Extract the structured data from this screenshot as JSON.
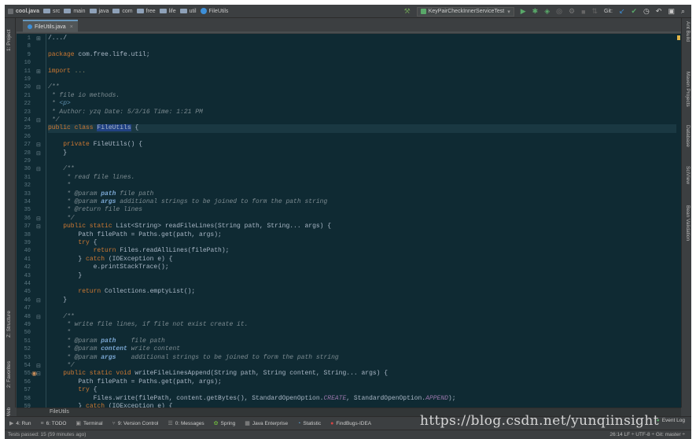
{
  "nav": {
    "crumbs": [
      {
        "label": "cool.java",
        "icon": "project-icon"
      },
      {
        "label": "src",
        "icon": "folder-icon"
      },
      {
        "label": "main",
        "icon": "folder-icon"
      },
      {
        "label": "java",
        "icon": "folder-icon"
      },
      {
        "label": "com",
        "icon": "folder-icon"
      },
      {
        "label": "free",
        "icon": "folder-icon"
      },
      {
        "label": "life",
        "icon": "folder-icon"
      },
      {
        "label": "util",
        "icon": "folder-icon"
      },
      {
        "label": "FileUtils",
        "icon": "class-icon"
      }
    ]
  },
  "toolbar": {
    "run_config": "KeyPairCheckInnerServiceTest",
    "git_label": "Git:"
  },
  "left_strip": {
    "project": "1: Project",
    "structure": "Z: Structure",
    "favorites": "2: Favorites",
    "web": "Web"
  },
  "right_strip": {
    "ant": "Ant Build",
    "maven": "Maven Projects",
    "database": "Database",
    "sciview": "SciView",
    "bean": "Bean Validation"
  },
  "tab": {
    "label": "FileUtils.java",
    "close": "×"
  },
  "code_lines": [
    {
      "n": "1",
      "html": "<span class='t'>/.../</span>"
    },
    {
      "n": "8",
      "html": ""
    },
    {
      "n": "9",
      "html": "<span class='k'>package </span><span class='t'>com.free.life.util;</span>"
    },
    {
      "n": "10",
      "html": ""
    },
    {
      "n": "11",
      "html": "<span class='k'>import </span><span class='t' style='color:#8a8a6a'>...</span>"
    },
    {
      "n": "19",
      "html": ""
    },
    {
      "n": "20",
      "html": "<span class='c'>/**</span>"
    },
    {
      "n": "21",
      "html": "<span class='c'> * file io methods.</span>"
    },
    {
      "n": "22",
      "html": "<span class='c'> * </span><span class='tg'>&lt;p&gt;</span>"
    },
    {
      "n": "23",
      "html": "<span class='c'> * Author: yzq Date: 5/3/16 Time: 1:21 PM</span>"
    },
    {
      "n": "24",
      "html": "<span class='c'> */</span>"
    },
    {
      "n": "25",
      "html": "<span class='k'>public class </span><span class='sel'>FileUtils</span><span class='t'> {</span>",
      "hl": true
    },
    {
      "n": "26",
      "html": ""
    },
    {
      "n": "27",
      "html": "    <span class='k'>private </span><span class='t'>FileUtils() {</span>"
    },
    {
      "n": "28",
      "html": "    <span class='t'>}</span>"
    },
    {
      "n": "29",
      "html": ""
    },
    {
      "n": "30",
      "html": "    <span class='c'>/**</span>"
    },
    {
      "n": "31",
      "html": "    <span class='c'> * read file lines.</span>"
    },
    {
      "n": "32",
      "html": "    <span class='c'> *</span>"
    },
    {
      "n": "33",
      "html": "    <span class='c'> * @param </span><span class='p'>path</span><span class='c'> file path</span>"
    },
    {
      "n": "34",
      "html": "    <span class='c'> * @param </span><span class='p'>args</span><span class='c'> additional strings to be joined to form the path string</span>"
    },
    {
      "n": "35",
      "html": "    <span class='c'> * @return file lines</span>"
    },
    {
      "n": "36",
      "html": "    <span class='c'> */</span>"
    },
    {
      "n": "37",
      "html": "    <span class='k'>public static </span><span class='t'>List&lt;String&gt; readFileLines(String path, String... args) {</span>"
    },
    {
      "n": "38",
      "html": "        <span class='t'>Path filePath = Paths.get(path, args);</span>"
    },
    {
      "n": "39",
      "html": "        <span class='k'>try </span><span class='t'>{</span>"
    },
    {
      "n": "40",
      "html": "            <span class='k'>return </span><span class='t'>Files.readAllLines(filePath);</span>"
    },
    {
      "n": "41",
      "html": "        <span class='t'>} </span><span class='k'>catch </span><span class='t'>(IOException e) {</span>"
    },
    {
      "n": "42",
      "html": "            <span class='t'>e.printStackTrace();</span>"
    },
    {
      "n": "43",
      "html": "        <span class='t'>}</span>"
    },
    {
      "n": "44",
      "html": ""
    },
    {
      "n": "45",
      "html": "        <span class='k'>return </span><span class='t'>Collections.emptyList();</span>"
    },
    {
      "n": "46",
      "html": "    <span class='t'>}</span>"
    },
    {
      "n": "47",
      "html": ""
    },
    {
      "n": "48",
      "html": "    <span class='c'>/**</span>"
    },
    {
      "n": "49",
      "html": "    <span class='c'> * write file lines, if file not exist create it.</span>"
    },
    {
      "n": "50",
      "html": "    <span class='c'> *</span>"
    },
    {
      "n": "51",
      "html": "    <span class='c'> * @param </span><span class='p'>path</span><span class='c'>    file path</span>"
    },
    {
      "n": "52",
      "html": "    <span class='c'> * @param </span><span class='p'>content</span><span class='c'> write content</span>"
    },
    {
      "n": "53",
      "html": "    <span class='c'> * @param </span><span class='p'>args</span><span class='c'>    additional strings to be joined to form the path string</span>"
    },
    {
      "n": "54",
      "html": "    <span class='c'> */</span>"
    },
    {
      "n": "55",
      "html": "    <span class='k'>public static void </span><span class='t'>writeFileLinesAppend(String path, String content, String... args) {</span>",
      "at": true
    },
    {
      "n": "56",
      "html": "        <span class='t'>Path filePath = Paths.get(path, args);</span>"
    },
    {
      "n": "57",
      "html": "        <span class='k'>try </span><span class='t'>{</span>"
    },
    {
      "n": "58",
      "html": "            <span class='t'>Files.write(filePath, content.getBytes(), StandardOpenOption.</span><span class='a'>CREATE</span><span class='t'>, StandardOpenOption.</span><span class='a'>APPEND</span><span class='t'>);</span>"
    },
    {
      "n": "59",
      "html": "        <span class='t'>} </span><span class='k'>catch </span><span class='t'>(IOException e) {</span>"
    }
  ],
  "breadcrumb_bottom": "FileUtils",
  "bottom_tabs": [
    {
      "label": "4: Run",
      "icon": "run-icon",
      "glyph": "▶"
    },
    {
      "label": "6: TODO",
      "icon": "todo-icon",
      "glyph": "≡"
    },
    {
      "label": "Terminal",
      "icon": "terminal-icon",
      "glyph": "▣"
    },
    {
      "label": "9: Version Control",
      "icon": "vcs-icon",
      "glyph": "⑂"
    },
    {
      "label": "0: Messages",
      "icon": "messages-icon",
      "glyph": "☰"
    },
    {
      "label": "Spring",
      "icon": "spring-icon",
      "glyph": "✿"
    },
    {
      "label": "Java Enterprise",
      "icon": "java-enterprise-icon",
      "glyph": "▦"
    },
    {
      "label": "Statistic",
      "icon": "statistic-icon",
      "glyph": "◔"
    },
    {
      "label": "FindBugs-IDEA",
      "icon": "findbugs-icon",
      "glyph": "●"
    }
  ],
  "event_log": "Event Log",
  "status": {
    "left": "Tests passed: 15 (59 minutes ago)",
    "right": "26:14  LF ÷  UTF-8 ÷  Git: master ÷"
  },
  "watermark": "https://blog.csdn.net/yunqiinsight"
}
